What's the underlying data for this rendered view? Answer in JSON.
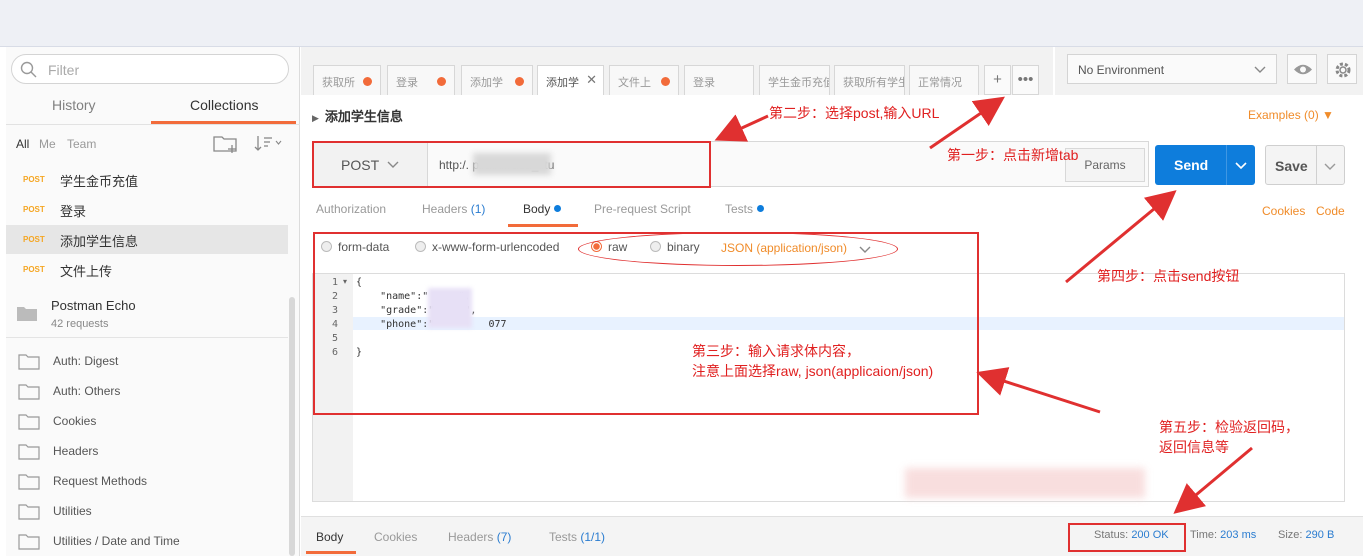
{
  "sidebar": {
    "filter_placeholder": "Filter",
    "tabs": [
      "History",
      "Collections"
    ],
    "scopes": [
      "All",
      "Me",
      "Team"
    ],
    "requests": [
      {
        "method": "POST",
        "name": "学生金币充值"
      },
      {
        "method": "POST",
        "name": "登录"
      },
      {
        "method": "POST",
        "name": "添加学生信息"
      },
      {
        "method": "POST",
        "name": "文件上传"
      }
    ],
    "collection": {
      "title": "Postman Echo",
      "subtitle": "42 requests"
    },
    "folders": [
      "Auth: Digest",
      "Auth: Others",
      "Cookies",
      "Headers",
      "Request Methods",
      "Utilities",
      "Utilities / Date and Time"
    ]
  },
  "tabs": [
    "获取所",
    "登录",
    "添加学",
    "添加学",
    "文件上",
    "登录",
    "学生金币充值",
    "获取所有学生",
    "正常情况"
  ],
  "environment": "No Environment",
  "request": {
    "title": "添加学生信息",
    "examples": "Examples (0) ▼",
    "method": "POST",
    "url": "http:/.               pi/user/add_stu",
    "params": "Params",
    "send": "Send",
    "save": "Save"
  },
  "request_tabs": {
    "authorization": "Authorization",
    "headers": "Headers",
    "headers_count": "(1)",
    "body": "Body",
    "prerequest": "Pre-request Script",
    "tests": "Tests",
    "cookies": "Cookies",
    "code": "Code"
  },
  "body_types": {
    "form_data": "form-data",
    "urlencoded": "x-www-form-urlencoded",
    "raw": "raw",
    "binary": "binary",
    "json": "JSON (application/json)"
  },
  "editor": {
    "line_numbers": [
      "1",
      "2",
      "3",
      "4",
      "5",
      "6"
    ],
    "lines": [
      "{",
      "    \"name\":\"     \",",
      "    \"grade\":\"     \",",
      "    \"phone\":\"         077",
      "",
      "}"
    ]
  },
  "response": {
    "tabs": {
      "body": "Body",
      "cookies": "Cookies",
      "headers": "Headers",
      "headers_count": "(7)",
      "tests": "Tests",
      "tests_count": "(1/1)"
    },
    "status_label": "Status:",
    "status_value": "200 OK",
    "time_label": "Time:",
    "time_value": "203 ms",
    "size_label": "Size:",
    "size_value": "290 B"
  },
  "annotations": {
    "step2": "第二步：选择post,输入URL",
    "step1": "第一步：点击新增tab",
    "step4": "第四步：点击send按钮",
    "step3_line1": "第三步：输入请求体内容，",
    "step3_line2": "注意上面选择raw, json(applicaion/json)",
    "step5_line1": "第五步：检验返回码，",
    "step5_line2": "返回信息等"
  },
  "colors": {
    "accent": "#f26b3a",
    "send_blue": "#0e7ddc",
    "annotation_red": "#e03030"
  }
}
